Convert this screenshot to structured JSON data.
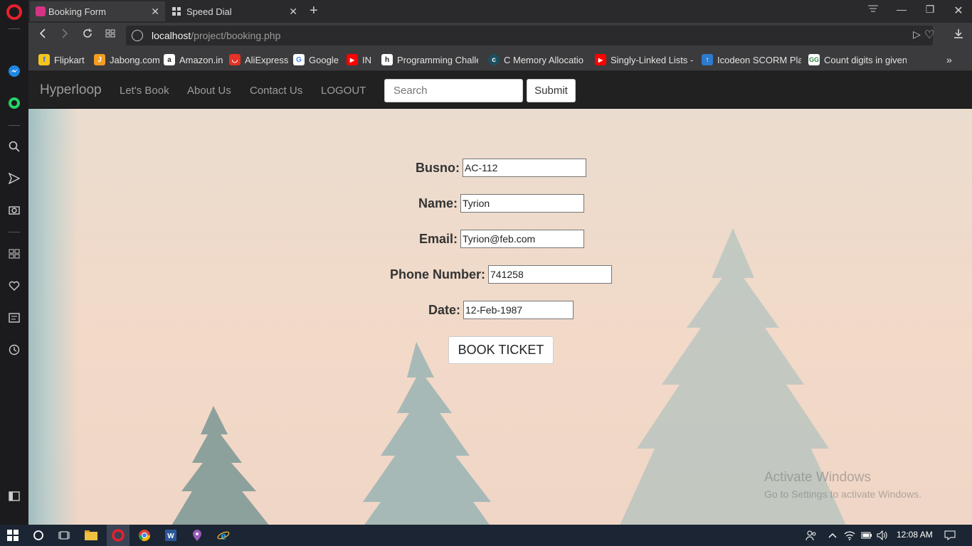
{
  "browser": {
    "tabs": [
      {
        "label": "Booking Form",
        "active": true
      },
      {
        "label": "Speed Dial",
        "active": false
      }
    ],
    "url_host": "localhost",
    "url_path": "/project/booking.php",
    "bookmarks": [
      {
        "label": "Flipkart",
        "icon": "flipkart-icon",
        "color": "#f7c61b"
      },
      {
        "label": "Jabong.com",
        "icon": "jabong-icon",
        "color": "#f49b22"
      },
      {
        "label": "Amazon.in",
        "icon": "amazon-icon",
        "color": "#ffffff"
      },
      {
        "label": "AliExpress",
        "icon": "aliexpress-icon",
        "color": "#e43225"
      },
      {
        "label": "Google",
        "icon": "google-icon",
        "color": "#ffffff"
      },
      {
        "label": "IN",
        "icon": "youtube-icon",
        "color": "#ff0000"
      },
      {
        "label": "Programming Challe",
        "icon": "hackerrank-icon",
        "color": "#ffffff"
      },
      {
        "label": "C Memory Allocatio",
        "icon": "c-icon",
        "color": "#1e4f5e"
      },
      {
        "label": "Singly-Linked Lists - Y",
        "icon": "youtube-icon",
        "color": "#ff0000"
      },
      {
        "label": "Icodeon SCORM Play",
        "icon": "icodeon-icon",
        "color": "#2b7bd0"
      },
      {
        "label": "Count digits in given",
        "icon": "gfg-icon",
        "color": "#2f8d46"
      }
    ]
  },
  "navbar": {
    "brand": "Hyperloop",
    "links": [
      "Let's Book",
      "About Us",
      "Contact Us",
      "LOGOUT"
    ],
    "search_placeholder": "Search",
    "submit_label": "Submit"
  },
  "form": {
    "busno_label": "Busno:",
    "busno_value": "AC-112",
    "name_label": "Name:",
    "name_value": "Tyrion",
    "email_label": "Email:",
    "email_value": "Tyrion@feb.com",
    "phone_label": "Phone Number:",
    "phone_value": "741258",
    "date_label": "Date:",
    "date_value": "12-Feb-1987",
    "book_label": "BOOK TICKET"
  },
  "watermark": {
    "line1": "Activate Windows",
    "line2": "Go to Settings to activate Windows."
  },
  "taskbar": {
    "clock": "12:08 AM"
  }
}
